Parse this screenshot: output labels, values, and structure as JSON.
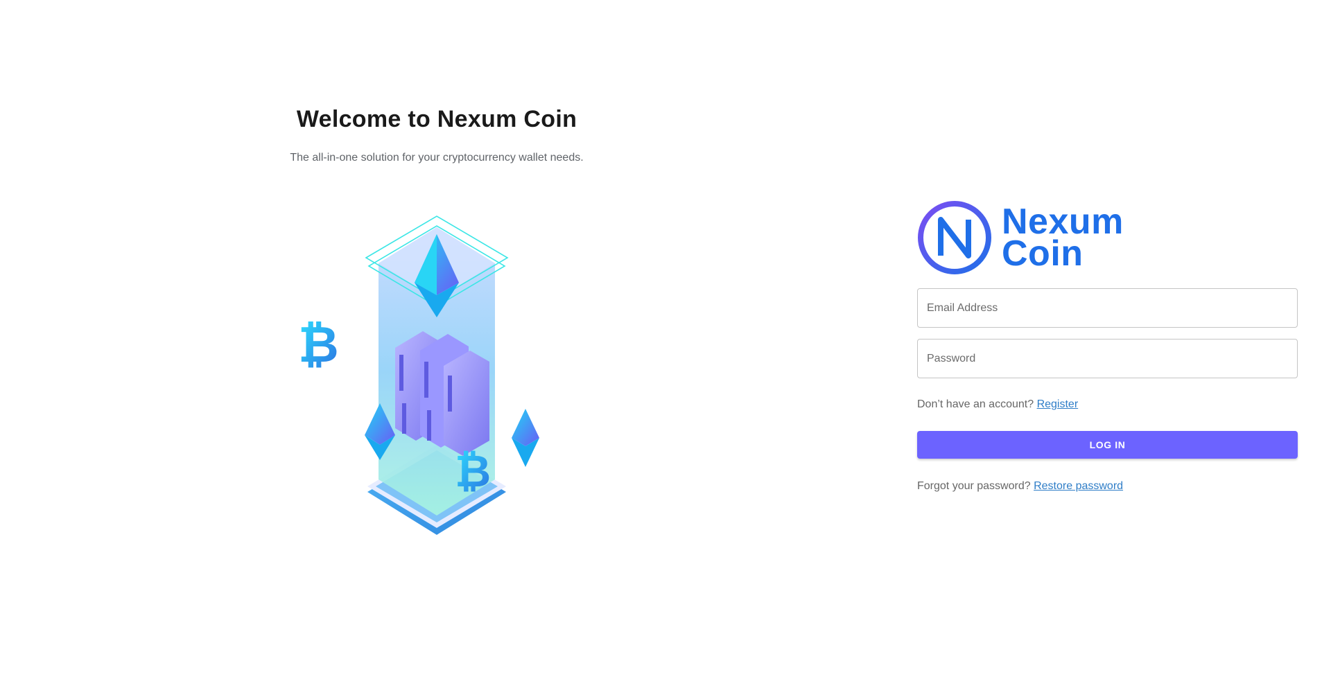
{
  "hero": {
    "title": "Welcome to Nexum Coin",
    "subtitle": "The all-in-one solution for your cryptocurrency wallet needs."
  },
  "logo": {
    "mark_letter": "N",
    "line1": "Nexum",
    "line2": "Coin"
  },
  "form": {
    "email_placeholder": "Email Address",
    "password_placeholder": "Password",
    "register_prompt": "Don’t have an account?",
    "register_link": "Register",
    "login_button": "LOG IN",
    "forgot_prompt": "Forgot your password?",
    "restore_link": "Restore password"
  },
  "colors": {
    "accent": "#6c63ff",
    "brand_blue": "#1f6fe8",
    "link": "#2e7dc7"
  }
}
